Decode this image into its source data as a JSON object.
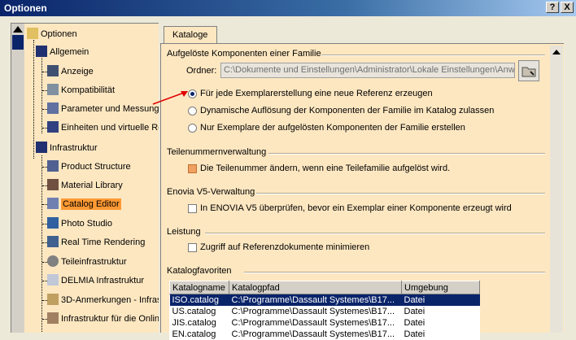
{
  "window": {
    "title": "Optionen",
    "help_label": "?",
    "close_label": "X"
  },
  "tree": {
    "items": [
      {
        "label": "Optionen"
      },
      {
        "label": "Allgemein"
      },
      {
        "label": "Anzeige"
      },
      {
        "label": "Kompatibilität"
      },
      {
        "label": "Parameter und Messunge"
      },
      {
        "label": "Einheiten und virtuelle Re"
      },
      {
        "label": "Infrastruktur"
      },
      {
        "label": "Product Structure"
      },
      {
        "label": "Material Library"
      },
      {
        "label": "Catalog Editor"
      },
      {
        "label": "Photo Studio"
      },
      {
        "label": "Real Time Rendering"
      },
      {
        "label": "Teileinfrastruktur"
      },
      {
        "label": "DELMIA Infrastruktur"
      },
      {
        "label": "3D-Anmerkungen - Infras"
      },
      {
        "label": "Infrastruktur für die Onlin"
      }
    ]
  },
  "tab": {
    "label": "Kataloge"
  },
  "section_resolved": {
    "title": "Aufgelöste Komponenten einer Familie",
    "folder_label": "Ordner:",
    "folder_value": "C:\\Dokumente und Einstellungen\\Administrator\\Lokale Einstellungen\\Anwen",
    "options": [
      "Für jede Exemplarerstellung eine neue Referenz erzeugen",
      "Dynamische Auflösung der Komponenten der Familie im Katalog zulassen",
      "Nur Exemplare der aufgelösten Komponenten der Familie erstellen"
    ],
    "selected_index": 0
  },
  "section_parts": {
    "title": "Teilenummernverwaltung",
    "checkbox_label": "Die Teilenummer ändern, wenn eine Teilefamilie aufgelöst wird."
  },
  "section_enovia": {
    "title": "Enovia V5-Verwaltung",
    "checkbox_label": "In ENOVIA V5 überprüfen, bevor ein Exemplar einer Komponente erzeugt wird"
  },
  "section_perf": {
    "title": "Leistung",
    "checkbox_label": "Zugriff auf Referenzdokumente minimieren"
  },
  "section_fav": {
    "title": "Katalogfavoriten",
    "columns": [
      "Katalogname",
      "Katalogpfad",
      "Umgebung"
    ],
    "rows": [
      {
        "name": "ISO.catalog",
        "path": "C:\\Programme\\Dassault Systemes\\B17...",
        "env": "Datei"
      },
      {
        "name": "US.catalog",
        "path": "C:\\Programme\\Dassault Systemes\\B17...",
        "env": "Datei"
      },
      {
        "name": "JIS.catalog",
        "path": "C:\\Programme\\Dassault Systemes\\B17...",
        "env": "Datei"
      },
      {
        "name": "EN.catalog",
        "path": "C:\\Programme\\Dassault Systemes\\B17...",
        "env": "Datei"
      }
    ]
  },
  "colors": {
    "titlebar": "#0a246a",
    "panel": "#fde7c1",
    "selection": "#ff9933",
    "annotation_arrow": "#e00000"
  }
}
